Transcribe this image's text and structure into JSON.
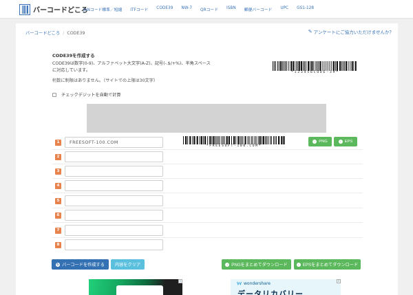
{
  "nav": {
    "logo_text": "バーコードどころ",
    "items": [
      "JANコード標準／短縮",
      "ITFコード",
      "CODE39",
      "NW-7",
      "QRコード",
      "ISBN",
      "郵便バーコード",
      "UPC",
      "GS1-128"
    ]
  },
  "breadcrumb": {
    "home": "バーコードどころ",
    "separator": "/",
    "current": "CODE39"
  },
  "survey_link": "アンケートにご協力いただけませんか？",
  "section": {
    "title": "CODE39を作成する",
    "description": "CODE39は数字(0-9)、アルファベット大文字(A-Z)、記号(-.$/+%)、半角スペースに対応しています。",
    "note": "桁数に制限はありません。（サイトでの上限は30文字）",
    "checkdigit_label": "チェックデジットを自動で計算"
  },
  "sample_barcode_text": "*123456CODE-39*",
  "rows": [
    {
      "number": "1",
      "value": "FREESOFT-100.COM",
      "barcode_text": "*FREESOFT-100.COM*",
      "png_label": "PNG",
      "eps_label": "EPS"
    },
    {
      "number": "2",
      "value": ""
    },
    {
      "number": "3",
      "value": ""
    },
    {
      "number": "4",
      "value": ""
    },
    {
      "number": "5",
      "value": ""
    },
    {
      "number": "6",
      "value": ""
    },
    {
      "number": "7",
      "value": ""
    },
    {
      "number": "8",
      "value": ""
    }
  ],
  "actions": {
    "create": "バーコードを作成する",
    "clear": "内容をクリア",
    "png_all": "PNGをまとめてダウンロード",
    "eps_all": "EPSをまとめてダウンロード"
  },
  "ad_right_brand": "wondershare",
  "ad_right_text": "データリカバリー",
  "colors": {
    "primary": "#3471b2",
    "success": "#5cb85c",
    "info": "#5bc0de",
    "row_number": "#e8834e",
    "link": "#3a73b8"
  }
}
